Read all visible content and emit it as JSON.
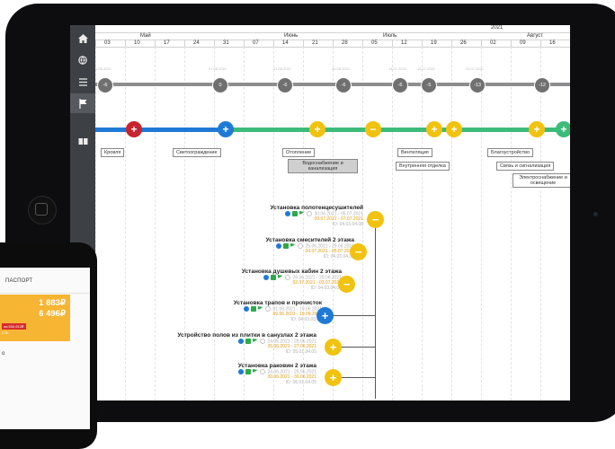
{
  "app": {
    "sidebar": [
      "home-icon",
      "globe-icon",
      "list-icon",
      "flag-icon",
      "book-icon"
    ],
    "year": "2021",
    "months": [
      "Май",
      "Июнь",
      "Июль",
      "Август"
    ],
    "weeks": [
      "03",
      "10",
      "17",
      "24",
      "31",
      "07",
      "14",
      "21",
      "28",
      "05",
      "12",
      "19",
      "26",
      "02",
      "09",
      "16"
    ]
  },
  "milestones": {
    "grey": [
      "-6",
      "0",
      "-6",
      "-6",
      "-6",
      "-5",
      "-13",
      "-12"
    ],
    "grey_dates": [
      "04.06.2021",
      "07.06.2021",
      "17.06.2021",
      "26.06.2021",
      "14.07.2021",
      "16.07.2021",
      "29.07.2021"
    ]
  },
  "stages": {
    "labels": [
      "Кровля",
      "Светоограждение",
      "Отопление",
      "Водоснабжение и канализация",
      "Вентиляция",
      "Внутренняя отделка",
      "Благоустройство",
      "Связь и сигнализация",
      "Электроснабжение и освещение"
    ]
  },
  "tasks": [
    {
      "title": "Установка полотенцесушителей",
      "plan": "30.06.2021 - 05.07.2021",
      "fact": "09.07.2021 - 07.07.2021",
      "id": "ID: 04.03.04.08",
      "type": "minus"
    },
    {
      "title": "Установка смесителей 2 этажа",
      "plan": "29.06.2021 - 29.06.2021",
      "fact": "04.07.2021 - 05.07.2021",
      "id": "ID: 04.03.04.09",
      "type": "minus"
    },
    {
      "title": "Установка душевых кабин 2 этажа",
      "plan": "29.06.2021 - 29.06.2021",
      "fact": "02.07.2021 - 03.07.2021",
      "id": "ID: 04.03.04.07",
      "type": "minus"
    },
    {
      "title": "Установка трапов и прочисток",
      "plan": "01.06.2021 - 10.06.2021",
      "fact": "09.06.2021 - 10.06.2021",
      "id": "ID: 04.03.03.05",
      "type": "plus-blue"
    },
    {
      "title": "Устройство полов из плитки в санузлах 2 этажа",
      "plan": "24.06.2021 - 25.06.2021",
      "fact": "26.06.2021 - 27.06.2021",
      "id": "ID: 05.01.04.05",
      "type": "plus"
    },
    {
      "title": "Установка раковин 2 этажа",
      "plan": "24.06.2021 - 25.06.2021",
      "fact": "30.06.2021 - 30.06.2021",
      "id": "ID: 06.01.04.05",
      "type": "plus"
    }
  ],
  "phone": {
    "tab": "ПАСПОРТ",
    "amount1": "1 883₽",
    "amount2": "6 496₽",
    "badge": "на 534 612₽",
    "small": "Сть",
    "para": "о"
  },
  "colors": {
    "blue": "#1f7ad6",
    "green": "#3dbb7a",
    "yellow": "#f1c20f",
    "red": "#c8232e",
    "grey": "#8e8e8e"
  }
}
